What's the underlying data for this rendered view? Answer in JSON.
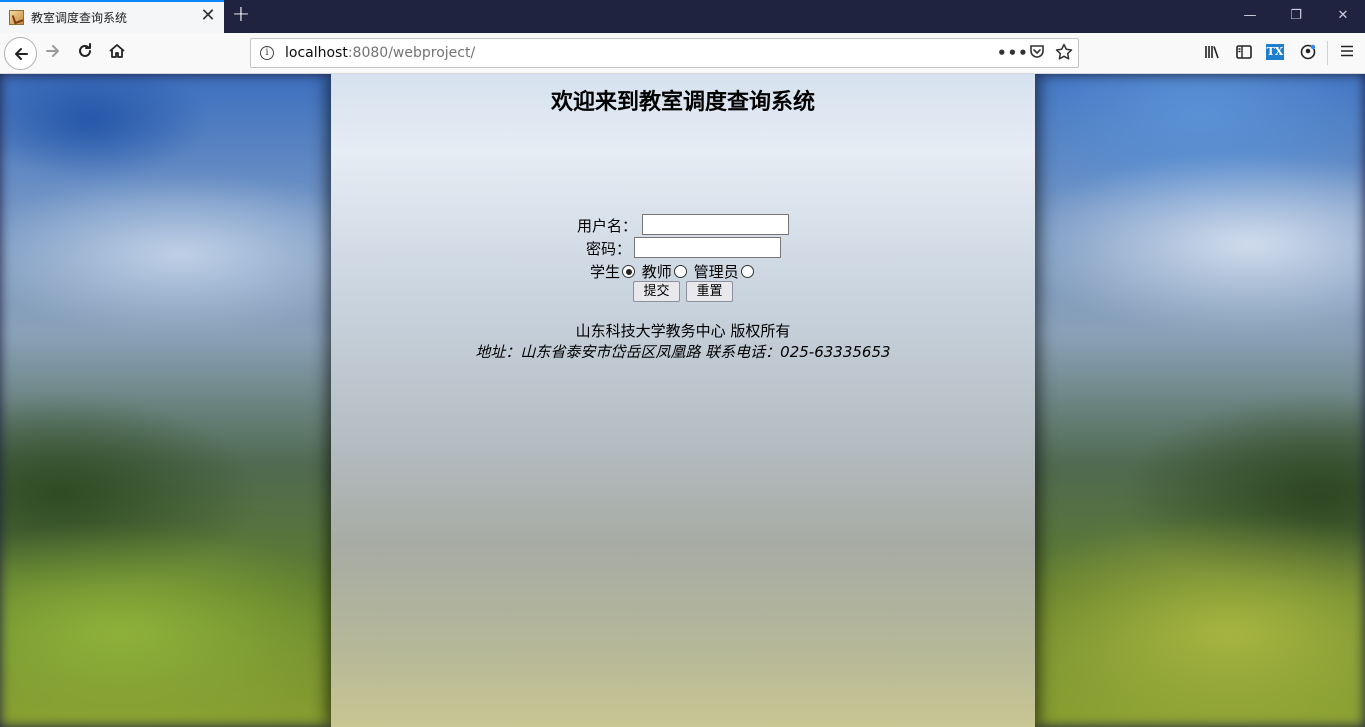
{
  "browser": {
    "tab_title": "教室调度查询系统",
    "tab_close": "✕",
    "new_tab": "+",
    "url_host": "localhost",
    "url_rest": ":8080/webproject/",
    "window_minimize": "—",
    "window_restore": "❐",
    "window_close": "✕"
  },
  "page": {
    "title": "欢迎来到教室调度查询系统",
    "username_label": "用户名：",
    "password_label": "密码：",
    "role_options": [
      {
        "label": "学生",
        "checked": true
      },
      {
        "label": "教师",
        "checked": false
      },
      {
        "label": "管理员",
        "checked": false
      }
    ],
    "submit_label": "提交",
    "reset_label": "重置",
    "footer_copyright": "山东科技大学教务中心  版权所有",
    "footer_address": "地址：山东省泰安市岱岳区凤凰路 联系电话：025-63335653"
  }
}
